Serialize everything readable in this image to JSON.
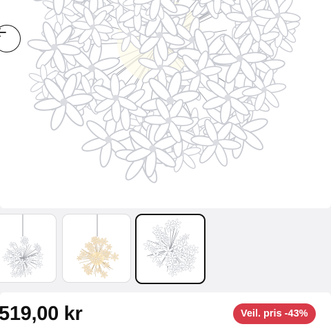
{
  "colors": {
    "background": "#f2f2f4",
    "card": "#ffffff",
    "badge": "#d93a48",
    "selected_border": "#111111"
  },
  "hero": {
    "back_icon": "arrow-left-icon",
    "image": "white flower pendant lamp"
  },
  "thumbnails": [
    {
      "image": "white flower pendant lamp",
      "selected": false
    },
    {
      "image": "cream flower pendant lamp",
      "selected": false
    },
    {
      "image": "white flower lamp close-up",
      "selected": true
    }
  ],
  "product": {
    "price": "519,00 kr",
    "badge": "Veil. pris -43%"
  }
}
